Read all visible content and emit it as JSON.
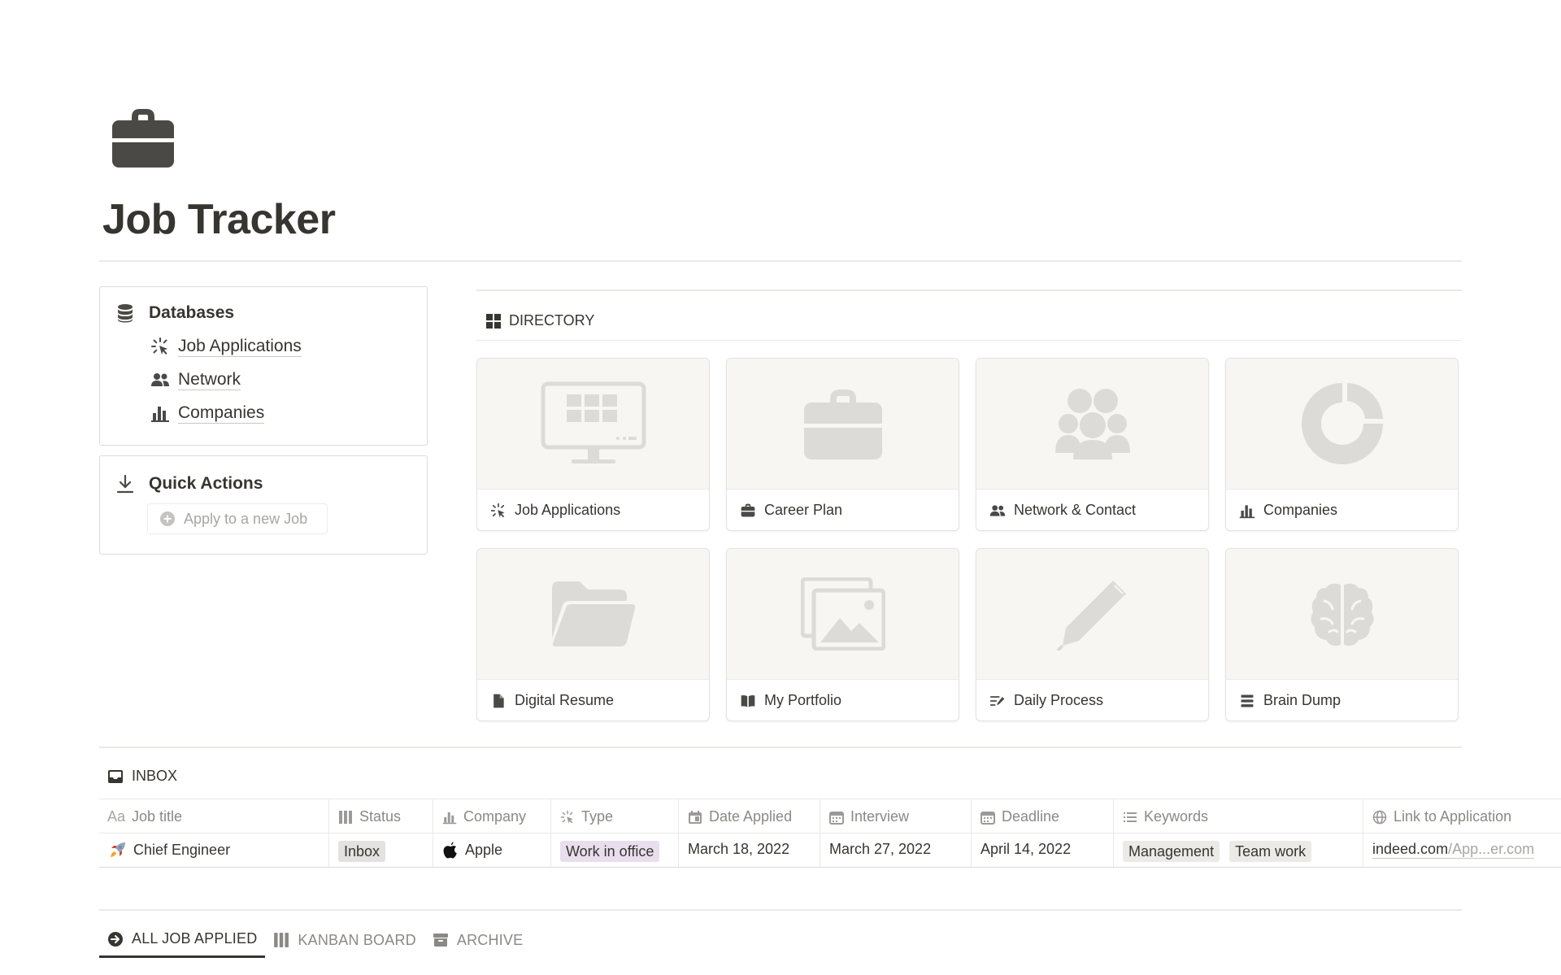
{
  "page": {
    "title": "Job Tracker",
    "icon": "briefcase-icon"
  },
  "databases": {
    "heading": "Databases",
    "icon": "database-icon",
    "items": [
      {
        "label": "Job Applications",
        "icon": "sparkle-click-icon"
      },
      {
        "label": "Network",
        "icon": "people-icon"
      },
      {
        "label": "Companies",
        "icon": "bar-chart-icon"
      }
    ]
  },
  "quick_actions": {
    "heading": "Quick Actions",
    "icon": "download-icon",
    "button_label": "Apply to a new Job",
    "button_icon": "plus-circle-icon"
  },
  "directory": {
    "heading": "DIRECTORY",
    "icon": "grid-icon",
    "cards": [
      {
        "label": "Job Applications",
        "icon": "sparkle-click-icon",
        "cover": "monitor-icon"
      },
      {
        "label": "Career Plan",
        "icon": "briefcase-icon",
        "cover": "briefcase-icon"
      },
      {
        "label": "Network & Contact",
        "icon": "people-icon",
        "cover": "group-icon"
      },
      {
        "label": "Companies",
        "icon": "bar-chart-icon",
        "cover": "donut-chart-icon"
      },
      {
        "label": "Digital Resume",
        "icon": "document-icon",
        "cover": "folder-icon"
      },
      {
        "label": "My Portfolio",
        "icon": "book-open-icon",
        "cover": "images-icon"
      },
      {
        "label": "Daily Process",
        "icon": "edit-list-icon",
        "cover": "pen-icon"
      },
      {
        "label": "Brain Dump",
        "icon": "stack-icon",
        "cover": "brain-icon"
      }
    ]
  },
  "inbox": {
    "heading": "INBOX",
    "icon": "inbox-tray-icon",
    "columns": [
      {
        "label": "Job title",
        "prefix": "Aa"
      },
      {
        "label": "Status",
        "icon": "columns-icon"
      },
      {
        "label": "Company",
        "icon": "bar-chart-icon"
      },
      {
        "label": "Type",
        "icon": "sparkle-click-icon"
      },
      {
        "label": "Date Applied",
        "icon": "calendar-check-icon"
      },
      {
        "label": "Interview",
        "icon": "calendar-icon"
      },
      {
        "label": "Deadline",
        "icon": "calendar-icon"
      },
      {
        "label": "Keywords",
        "icon": "list-icon"
      },
      {
        "label": "Link to Application",
        "icon": "globe-icon"
      }
    ],
    "rows": [
      {
        "job_title": "Chief Engineer",
        "job_icon": "rocket-icon",
        "status": "Inbox",
        "company": "Apple",
        "company_icon": "apple-logo-icon",
        "type": "Work in office",
        "date_applied": "March 18, 2022",
        "interview": "March 27, 2022",
        "deadline": "April 14, 2022",
        "keywords": [
          "Management",
          "Team work"
        ],
        "link_host": "indeed.com",
        "link_path": "/App...er.com"
      }
    ],
    "colors": {
      "status_tag_bg": "#e3e2e0",
      "type_tag_bg": "#e8deee",
      "keyword_tag_bg": "#ebeae7"
    }
  },
  "views": {
    "tabs": [
      {
        "label": "ALL JOB APPLIED",
        "icon": "arrow-circle-icon",
        "active": true
      },
      {
        "label": "KANBAN BOARD",
        "icon": "columns-icon",
        "active": false
      },
      {
        "label": "ARCHIVE",
        "icon": "archive-box-icon",
        "active": false
      }
    ]
  }
}
